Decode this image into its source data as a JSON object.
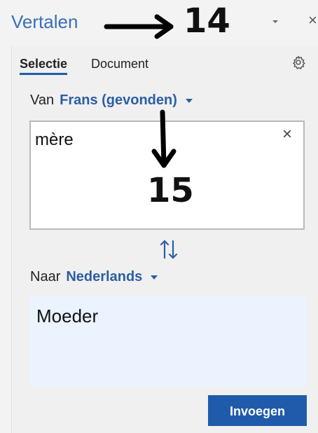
{
  "window": {
    "title": "Vertalen",
    "close_glyph": "×"
  },
  "tabs": [
    {
      "label": "Selectie",
      "active": true
    },
    {
      "label": "Document",
      "active": false
    }
  ],
  "source": {
    "label": "Van",
    "language": "Frans (gevonden)",
    "text": "mère",
    "clear_glyph": "×"
  },
  "target": {
    "label": "Naar",
    "language": "Nederlands",
    "text": "Moeder"
  },
  "actions": {
    "insert_label": "Invoegen"
  },
  "annotations": {
    "a1": "14",
    "a2": "15"
  },
  "colors": {
    "accent": "#1f5baa",
    "title": "#3a6fb6",
    "output_bg": "#eaf3fe"
  },
  "icons": {
    "settings": "gear-icon",
    "swap": "swap-arrows-icon",
    "dropdown": "chevron-down-icon",
    "close": "close-icon"
  }
}
